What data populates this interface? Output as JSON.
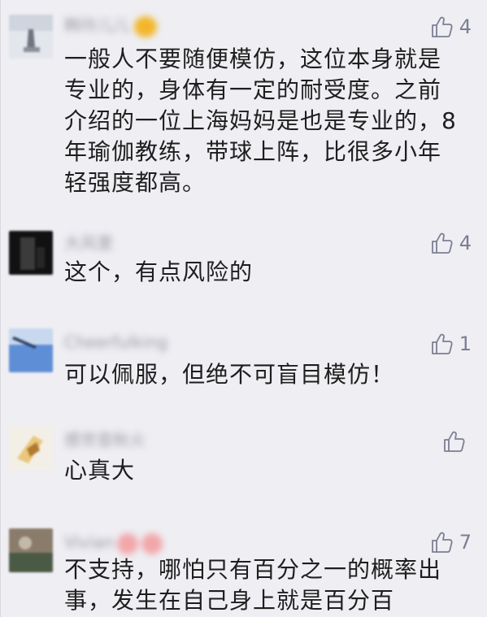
{
  "comments": [
    {
      "username": "韩玲儿儿",
      "likes": "4",
      "lines": [
        "一般人不要随便模仿，这位本身就是",
        "专业的，身体有一定的耐受度。之前",
        "介绍的一位上海妈妈是也是专业的，8",
        "年瑜伽教练，带球上阵，比很多小年",
        "轻强度都高。"
      ],
      "avatar_colors": [
        "#e3e6ec",
        "#6f7480"
      ]
    },
    {
      "username": "大风里",
      "likes": "4",
      "lines": [
        "这个，有点风险的"
      ],
      "avatar_colors": [
        "#111111",
        "#3b3b3b"
      ]
    },
    {
      "username": "Cheerfulking",
      "likes": "1",
      "lines": [
        "可以佩服，但绝不可盲目模仿！"
      ],
      "avatar_colors": [
        "#5e8fd6",
        "#c8d8ee"
      ]
    },
    {
      "username": "感世音秋火",
      "likes": "",
      "lines": [
        "心真大"
      ],
      "avatar_colors": [
        "#e9c77d",
        "#b27a2f"
      ]
    },
    {
      "username": "Vivian",
      "likes": "7",
      "lines": [
        "不支持，哪怕只有百分之一的概率出",
        "事，发生在自己身上就是百分百"
      ],
      "avatar_colors": [
        "#8a7c6a",
        "#4b5a45"
      ]
    }
  ]
}
